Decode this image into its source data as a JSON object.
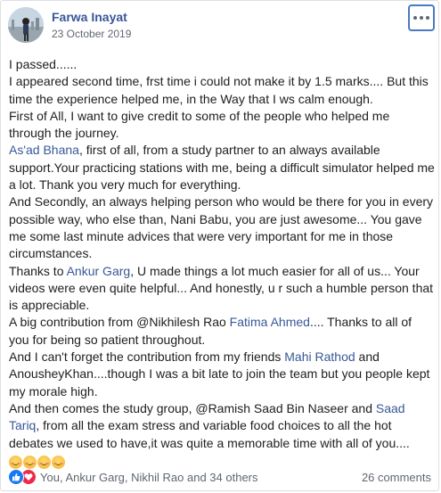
{
  "post": {
    "author": "Farwa Inayat",
    "date": "23 October 2019",
    "paragraphs": [
      {
        "segments": [
          {
            "text": "I passed......"
          }
        ]
      },
      {
        "segments": [
          {
            "text": "I appeared second time, frst time i could not make it by 1.5 marks.... But this time the experience helped me, in the Way that I ws calm enough."
          }
        ]
      },
      {
        "segments": [
          {
            "text": "First of All, I want to give credit to some of the people who helped me through the journey."
          }
        ]
      },
      {
        "segments": [
          {
            "text": "As'ad Bhana",
            "tag": true
          },
          {
            "text": ", first of all, from a study partner to an always available support.Your practicing stations with me, being a difficult simulator helped me a lot. Thank you very much for everything."
          }
        ]
      },
      {
        "segments": [
          {
            "text": "And Secondly, an always helping person who would be there for you in every possible way, who else than, Nani Babu, you are just awesome... You gave me some last minute advices that were very important for me in those circumstances."
          }
        ]
      },
      {
        "segments": [
          {
            "text": "Thanks to "
          },
          {
            "text": "Ankur Garg",
            "tag": true
          },
          {
            "text": ", U made things a lot much easier for all of us... Your videos were even quite helpful... And honestly, u r such a humble person that is appreciable."
          }
        ]
      },
      {
        "segments": [
          {
            "text": "A big contribution from @Nikhilesh Rao "
          },
          {
            "text": "Fatima Ahmed",
            "tag": true
          },
          {
            "text": ".... Thanks to all of you for being so patient throughout."
          }
        ]
      },
      {
        "segments": [
          {
            "text": "And I can't forget the contribution from my friends "
          },
          {
            "text": "Mahi Rathod",
            "tag": true
          },
          {
            "text": " and AnousheyKhan....though I was a bit late to join the team but you people kept my morale high."
          }
        ]
      },
      {
        "segments": [
          {
            "text": "And then comes the study group, @Ramish Saad Bin Naseer and "
          },
          {
            "text": "Saad Tariq",
            "tag": true
          },
          {
            "text": ", from all the exam stress and variable food choices to all the hot debates we used to have,it was quite a memorable time with all of you...."
          }
        ]
      }
    ],
    "emoji_count": 4
  },
  "footer": {
    "reactions": [
      "like",
      "love"
    ],
    "likers": "You, Ankur Garg, Nikhil Rao and 34 others",
    "comments": "26 comments"
  },
  "colors": {
    "link": "#385898",
    "text": "#1c1e21",
    "muted": "#606770",
    "like": "#1878f3",
    "love": "#f0284a"
  }
}
